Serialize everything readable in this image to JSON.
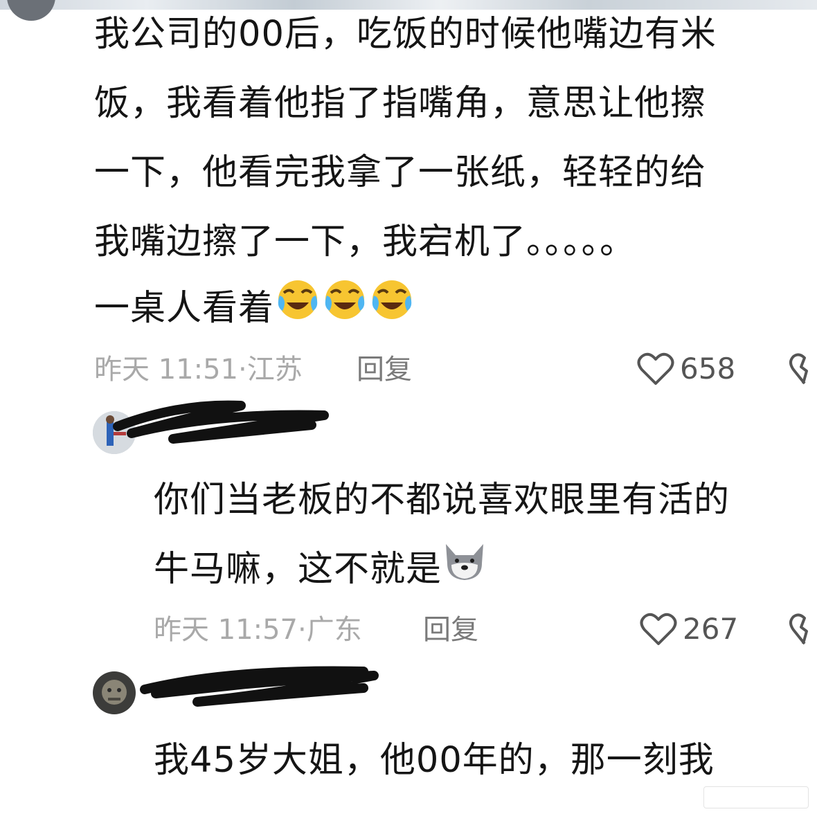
{
  "comments": [
    {
      "lines": [
        "我公司的00后，吃饭的时候他嘴边有米",
        "饭，我看着他指了指嘴角，意思让他擦",
        "一下，他看完我拿了一张纸，轻轻的给",
        "我嘴边擦了一下，我宕机了。。。。。",
        "一桌人看着"
      ],
      "emoji": "crying-laugh-emoji ×3",
      "time": "昨天 11:51·",
      "location": "江苏",
      "reply_label": "回复",
      "likes": "658"
    },
    {
      "username": "",
      "lines": [
        "你们当老板的不都说喜欢眼里有活的",
        "牛马嘛，这不就是"
      ],
      "emoji": "wolf-emoji",
      "time": "昨天 11:57·",
      "location": "广东",
      "reply_label": "回复",
      "likes": "267"
    },
    {
      "username": "",
      "lines": [
        "我45岁大姐，他00年的，那一刻我"
      ]
    }
  ]
}
